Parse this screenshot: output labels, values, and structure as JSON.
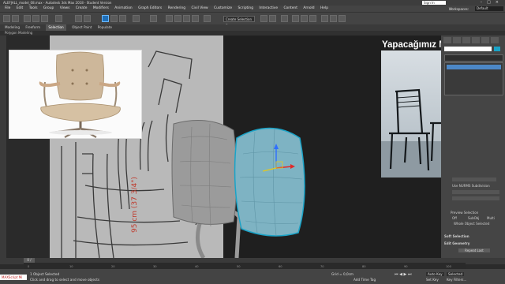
{
  "window": {
    "title": "ALEFJALL_model_08.max - Autodesk 3ds Max 2018 - Student Version",
    "signin_label": "Sign In",
    "workspaces_label": "Workspaces:",
    "workspace_value": "Default"
  },
  "menu": [
    "File",
    "Edit",
    "Tools",
    "Group",
    "Views",
    "Create",
    "Modifiers",
    "Animation",
    "Graph Editors",
    "Rendering",
    "Civil View",
    "Customize",
    "Scripting",
    "Interactive",
    "Content",
    "Arnold",
    "Help"
  ],
  "toolbar": {
    "view_dropdown": "Create Selection Se"
  },
  "ribbon": {
    "tabs": [
      "Modeling",
      "Freeform",
      "Selection",
      "Object Paint",
      "Populate"
    ],
    "active_index": 2,
    "sub_label": "Polygon Modeling"
  },
  "viewport": {
    "overlay_label": "Yapacağımız Modeller",
    "selection_color": "#1aa3c7",
    "dimension_text": "95 cm (37 3/4\")"
  },
  "command_panel": {
    "items": [
      "Use NURMS Subdivision",
      "Preview Selection",
      "Off",
      "SubObj",
      "Multi",
      "Whole Object Selected",
      "Soft Selection",
      "Edit Geometry",
      "Repeat Last"
    ],
    "radio_preview": [
      "Off",
      "SubObj",
      "Multi"
    ]
  },
  "timeline": {
    "frame_label": "0 / 100",
    "ticks": [
      "0",
      "10",
      "20",
      "30",
      "40",
      "50",
      "60",
      "70",
      "80",
      "90",
      "100"
    ]
  },
  "status": {
    "maxscript_label": "MAXScript Mi",
    "selection_status": "1 Object Selected",
    "prompt": "Click and drag to select and move objects",
    "grid": "Grid = 0,0cm",
    "add_time_tag": "Add Time Tag",
    "auto_key": "Auto Key",
    "selected": "Selected",
    "set_key": "Set Key",
    "key_filters": "Key Filters..."
  }
}
